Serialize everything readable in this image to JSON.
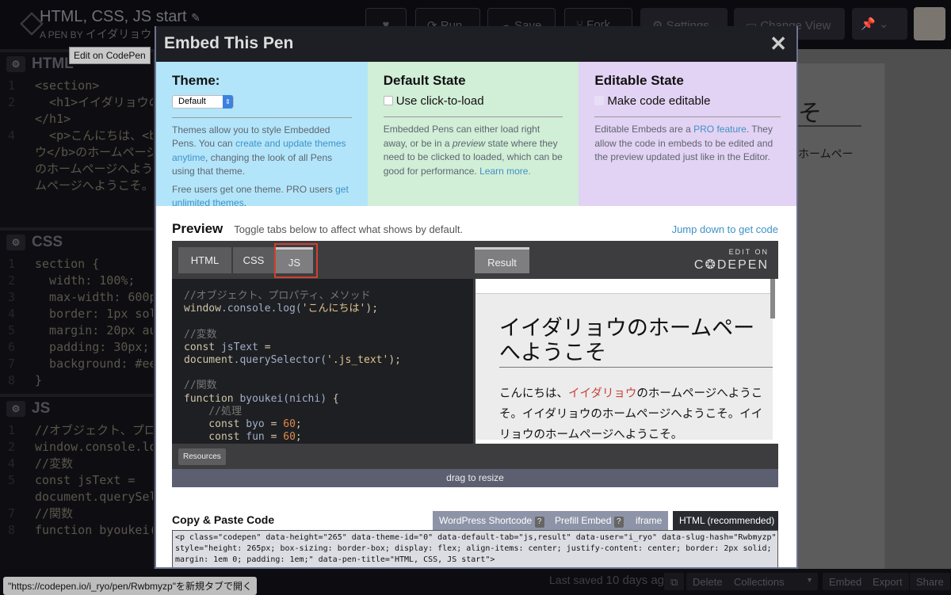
{
  "header": {
    "title": "HTML, CSS, JS start",
    "pen_by_label": "A PEN BY",
    "author": "イイダリョウ",
    "buttons": {
      "like": "♥",
      "run": "Run",
      "save": "Save",
      "fork": "Fork",
      "settings": "Settings",
      "change_view": "Change View"
    },
    "tooltip": "Edit on CodePen"
  },
  "editors": [
    {
      "label": "HTML",
      "lines": [
        {
          "n": "1",
          "t": "<section>"
        },
        {
          "n": "2",
          "t": "  <h1>イイダリョウの"
        },
        {
          "n": "",
          "t": "</h1>"
        },
        {
          "n": "3",
          "t": ""
        },
        {
          "n": "4",
          "t": "  <p>こんにちは、<b"
        },
        {
          "n": "",
          "t": "ウ</b>のホームページ"
        },
        {
          "n": "",
          "t": "のホームページへようこ"
        },
        {
          "n": "",
          "t": "ムページへようこそ。<"
        }
      ]
    },
    {
      "label": "CSS",
      "lines": [
        {
          "n": "1",
          "t": "section {"
        },
        {
          "n": "2",
          "t": "  width: 100%;"
        },
        {
          "n": "3",
          "t": "  max-width: 600px"
        },
        {
          "n": "4",
          "t": "  border: 1px soli"
        },
        {
          "n": "5",
          "t": "  margin: 20px aut"
        },
        {
          "n": "6",
          "t": "  padding: 30px;"
        },
        {
          "n": "7",
          "t": "  background: #eee"
        },
        {
          "n": "8",
          "t": "}"
        }
      ]
    },
    {
      "label": "JS",
      "lines": [
        {
          "n": "1",
          "t": "//オブジェクト、プロパ"
        },
        {
          "n": "2",
          "t": "window.console.log"
        },
        {
          "n": "3",
          "t": ""
        },
        {
          "n": "4",
          "t": "//変数"
        },
        {
          "n": "5",
          "t": "const jsText ="
        },
        {
          "n": "",
          "t": "document.querySele"
        },
        {
          "n": "6",
          "t": ""
        },
        {
          "n": "7",
          "t": "//関数"
        },
        {
          "n": "8",
          "t": "function byoukei("
        }
      ]
    }
  ],
  "background_result": {
    "heading_fragment": "そ",
    "text_fragment": "ホームペー"
  },
  "modal": {
    "title": "Embed This Pen",
    "close": "✕",
    "theme": {
      "heading": "Theme:",
      "select_value": "Default",
      "p1_a": "Themes allow you to style Embedded Pens. You can ",
      "p1_link": "create and update themes anytime",
      "p1_b": ", changing the look of all Pens using that theme.",
      "p2_a": "Free users get one theme. PRO users ",
      "p2_link": "get unlimited themes",
      "p2_b": ".",
      "bg": "#b3e5fa"
    },
    "default_state": {
      "heading": "Default State",
      "checkbox_label": "Use click-to-load",
      "checked": false,
      "p_a": "Embedded Pens can either load right away, or be in a ",
      "p_em": "preview",
      "p_b": " state where they need to be clicked to loaded, which can be good for performance. ",
      "p_link": "Learn more.",
      "bg": "#d1eed7"
    },
    "editable_state": {
      "heading": "Editable State",
      "checkbox_label": "Make code editable",
      "checked": false,
      "p_a": "Editable Embeds are a ",
      "p_link": "PRO feature",
      "p_b": ". They allow the code in embeds to be edited and the preview updated just like in the Editor.",
      "bg": "#e2d2f3"
    },
    "preview": {
      "heading": "Preview",
      "subtitle": "Toggle tabs below to affect what shows by default.",
      "jump_link": "Jump down to get code",
      "tabs": [
        "HTML",
        "CSS",
        "JS"
      ],
      "active_tab": "JS",
      "result_tab": "Result",
      "edit_on": "EDIT ON",
      "codepen": "C❂DEPEN",
      "js_code": [
        [
          [
            "cm",
            "//オブジェクト、プロパティ、メソッド"
          ]
        ],
        [
          [
            "fn",
            "window"
          ],
          [
            "id",
            ".console.log("
          ],
          [
            "st",
            "'こんにちは'"
          ],
          [
            "fn",
            ");"
          ]
        ],
        [],
        [
          [
            "cm",
            "//変数"
          ]
        ],
        [
          [
            "fn",
            "const "
          ],
          [
            "id",
            "jsText "
          ],
          [
            "fn",
            "="
          ]
        ],
        [
          [
            "fn",
            "document"
          ],
          [
            "id",
            ".querySelector("
          ],
          [
            "st",
            "'.js_text'"
          ],
          [
            "fn",
            ");"
          ]
        ],
        [],
        [
          [
            "cm",
            "//関数"
          ]
        ],
        [
          [
            "fn",
            "function "
          ],
          [
            "id",
            "byoukei(nichi) "
          ],
          [
            "fn",
            "{"
          ]
        ],
        [
          [
            "cm",
            "    //処理"
          ]
        ],
        [
          [
            "fn",
            "    const "
          ],
          [
            "id",
            "byo "
          ],
          [
            "fn",
            "= "
          ],
          [
            "nm",
            "60"
          ],
          [
            "fn",
            ";"
          ]
        ],
        [
          [
            "fn",
            "    const "
          ],
          [
            "id",
            "fun "
          ],
          [
            "fn",
            "= "
          ],
          [
            "nm",
            "60"
          ],
          [
            "fn",
            ";"
          ]
        ]
      ],
      "result_heading": "イイダリョウのホームペー\nへようこそ",
      "result_p1": "こんにちは、",
      "result_p_red": "イイダリョウ",
      "result_p2": "のホームページへようこ\nそ。イイダリョウのホームページへようこそ。イイ\nリョウのホームページへようこそ。",
      "resources": "Resources",
      "drag": "drag to resize"
    },
    "copy": {
      "heading": "Copy & Paste Code",
      "tabs": [
        "WordPress Shortcode",
        "Prefill Embed",
        "iframe",
        "HTML (recommended)"
      ],
      "help": "?",
      "active_tab": "HTML (recommended)",
      "code": "<p class=\"codepen\" data-height=\"265\" data-theme-id=\"0\" data-default-tab=\"js,result\" data-user=\"i_ryo\" data-slug-hash=\"Rwbmyzp\"\nstyle=\"height: 265px; box-sizing: border-box; display: flex; align-items: center; justify-content: center; border: 2px solid;\nmargin: 1em 0; padding: 1em;\" data-pen-title=\"HTML, CSS, JS start\">"
    }
  },
  "footer": {
    "last_saved": "Last saved",
    "last_saved_time": "10 days ago",
    "delete": "Delete",
    "collections": "Collections",
    "embed": "Embed",
    "export": "Export",
    "share": "Share",
    "url_tooltip": "\"https://codepen.io/i_ryo/pen/Rwbmyzp\"を新規タブで開く"
  }
}
